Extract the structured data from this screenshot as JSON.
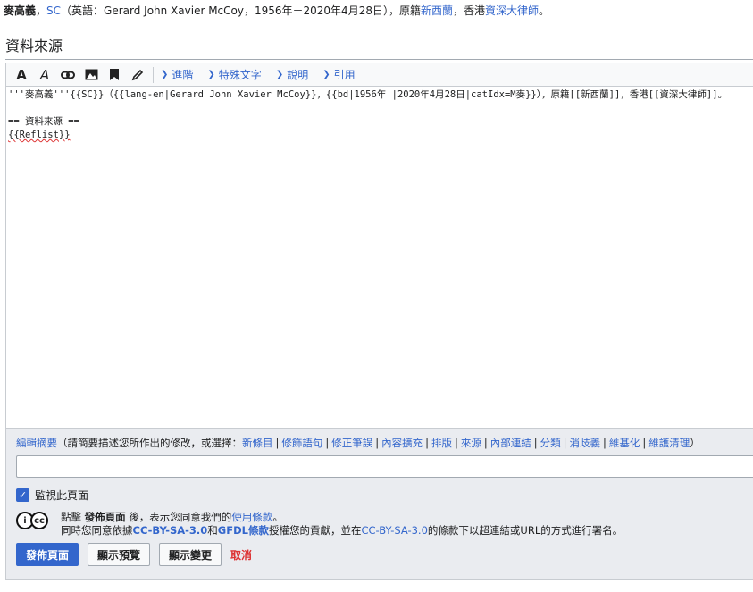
{
  "preview": {
    "name": "麥高義",
    "sc": "SC",
    "paren_open": "（英語：Gerard John Xavier McCoy，1956年－2020年4月28日），原籍",
    "country": "新西蘭",
    "mid": "，香港",
    "title_link": "資深大律師",
    "end": "。"
  },
  "section": {
    "heading": "資料來源"
  },
  "toolbar": {
    "tabs": [
      "進階",
      "特殊文字",
      "說明",
      "引用"
    ]
  },
  "editor": {
    "line1": "'''麥高義'''{{SC}}（{{lang-en|Gerard John Xavier McCoy}}，{{bd|1956年||2020年4月28日|catIdx=M麥}}），原籍[[新西蘭]]，香港[[資深大律師]]。",
    "line2": "",
    "line3": "== 資料來源 ==",
    "line4": "{{Reflist}}"
  },
  "summary": {
    "label": "編輯摘要",
    "hint": "（請簡要描述您所作出的修改，或選擇：",
    "tags": [
      "新條目",
      "修飾語句",
      "修正筆誤",
      "內容擴充",
      "排版",
      "來源",
      "內部連結",
      "分類",
      "消歧義",
      "維基化",
      "維護清理"
    ],
    "close": "）",
    "input_value": ""
  },
  "watch": {
    "label": "監視此頁面",
    "checked": true
  },
  "license": {
    "cc_label": "cc",
    "line1_pre": "點擊",
    "line1_bold": "發佈頁面",
    "line1_post": "後，表示您同意我們的",
    "terms": "使用條款",
    "line1_end": "。",
    "line2_pre": "同時您同意依據",
    "ccbysa": "CC-BY-SA-3.0",
    "and": "和",
    "gfdl": "GFDL條款",
    "line2_mid": "授權您的貢獻，並在",
    "ccbysa2": "CC-BY-SA-3.0",
    "line2_end": "的條款下以超連結或URL的方式進行署名。"
  },
  "actions": {
    "publish": "發佈頁面",
    "preview": "顯示預覽",
    "changes": "顯示變更",
    "cancel": "取消"
  }
}
